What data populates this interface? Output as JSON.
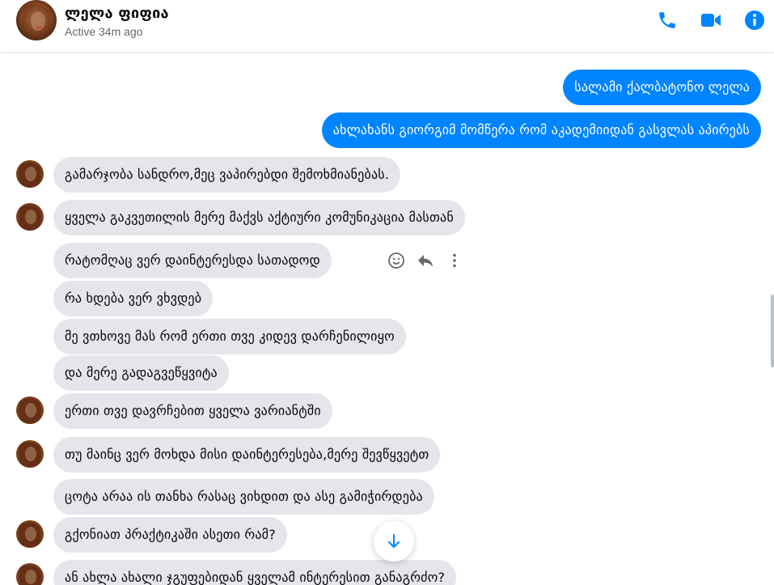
{
  "header": {
    "contact_name": "ლელა ფიფია",
    "status": "Active 34m ago",
    "icons": [
      "phone-icon",
      "video-icon",
      "info-icon"
    ],
    "accent_color": "#0084ff"
  },
  "messages": [
    {
      "direction": "out",
      "text": "სალამი ქალბატონო ლელა"
    },
    {
      "direction": "out",
      "text": "ახლახანს გიორგიმ მომწერა რომ აკადემიიდან გასვლას აპირებს"
    },
    {
      "direction": "in",
      "text": "გამარჯობა სანდრო,მეც ვაპირებდი შემოხმიანებას."
    },
    {
      "direction": "in",
      "text": "ყველა გაკვეთილის მერე მაქვს აქტიური კომუნიკაცია მასთან"
    },
    {
      "direction": "in",
      "text": "რატომღაც ვერ დაინტერესდა სათადოდ"
    },
    {
      "direction": "in",
      "text": "რა ხდება ვერ ვხვდებ"
    },
    {
      "direction": "in",
      "text": "მე ვთხოვე მას რომ ერთი თვე კიდევ დარჩენილიყო"
    },
    {
      "direction": "in",
      "text": "და მერე გადაგვეწყვიტა"
    },
    {
      "direction": "in",
      "text": "ერთი თვე დავრჩებით ყველა ვარიანტში"
    },
    {
      "direction": "in",
      "text": "თუ მაინც ვერ მოხდა მისი დაინტერესება,მერე შევწყვეტთ"
    },
    {
      "direction": "in",
      "text": "ცოტა არაა ის თანხა რასაც ვიხდით და ასე გამიჭირდება"
    },
    {
      "direction": "in",
      "text": "გქონიათ პრაქტიკაში ასეთი რამ?"
    },
    {
      "direction": "in",
      "text": "ან ახლა ახალი ჯგუფებიდან ყველამ ინტერესით განაგრძო?"
    }
  ],
  "hover_actions": [
    "emoji-react-icon",
    "reply-icon",
    "more-icon"
  ],
  "scroll_button": {
    "icon": "arrow-down-icon"
  }
}
